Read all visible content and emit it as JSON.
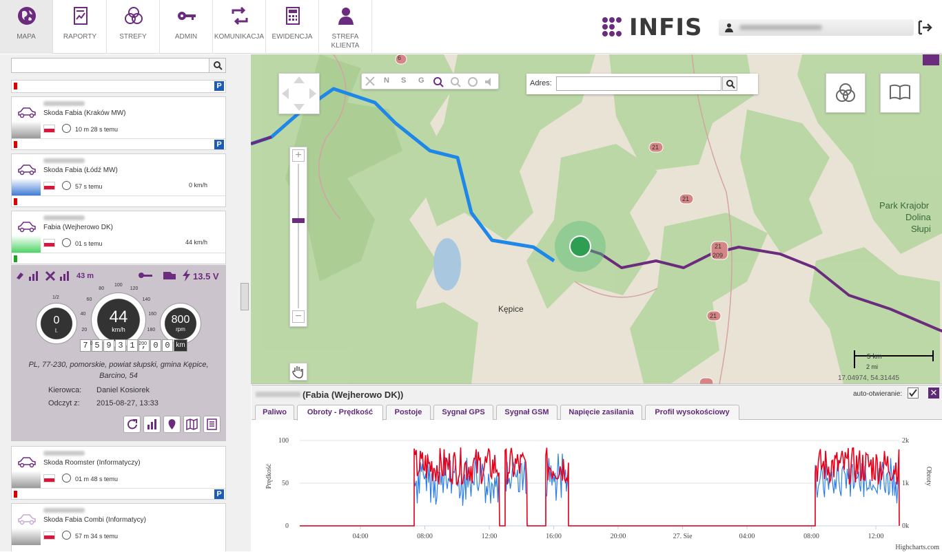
{
  "nav": [
    {
      "label": "MAPA",
      "icon": "globe-icon"
    },
    {
      "label": "RAPORTY",
      "icon": "report-icon"
    },
    {
      "label": "STREFY",
      "icon": "zones-icon"
    },
    {
      "label": "ADMIN",
      "icon": "key-icon"
    },
    {
      "label": "KOMUNIKACJA",
      "icon": "sync-icon"
    },
    {
      "label": "EWIDENCJA",
      "icon": "calculator-icon"
    },
    {
      "label": "STREFA KLIENTA",
      "icon": "user-icon"
    }
  ],
  "brand": {
    "logo": "INFIS",
    "accent": "#5e2a77"
  },
  "vehicles": [
    {
      "name": "Skoda Fabia (Kraków MW)",
      "time": "10 m 28 s temu",
      "speed": ""
    },
    {
      "name": "Skoda Fabia (Łódź MW)",
      "time": "57 s temu",
      "speed": "0 km/h"
    },
    {
      "name": "Fabia (Wejherowo DK)",
      "time": "01 s temu",
      "speed": "44 km/h"
    },
    {
      "name": "Skoda Roomster (Informatyczy)",
      "time": "01 m 48 s temu",
      "speed": ""
    },
    {
      "name": "Skoda Fabia Combi (Informatycy)",
      "time": "57 m 34 s temu",
      "speed": ""
    }
  ],
  "detail": {
    "altitude": "43 m",
    "voltage": "13.5 V",
    "fuel": "0",
    "fuel_unit": "l.",
    "fuel_ticks": [
      "1/2"
    ],
    "speed": "44",
    "speed_unit": "km/h",
    "speed_ticks": [
      "0",
      "20",
      "40",
      "60",
      "80",
      "100",
      "120",
      "140",
      "160",
      "180",
      "200"
    ],
    "rpm": "800",
    "rpm_unit": "rpm",
    "odometer": [
      "7",
      "5",
      "9",
      "3",
      "1",
      ",",
      "0",
      "0"
    ],
    "odo_unit": "km",
    "address_line1": "PL, 77-230, pomorskie, powiat słupski, gmina Kępice,",
    "address_line2": "Barcino, 54",
    "driver_label": "Kierowca:",
    "driver": "Daniel Kosiorek",
    "reading_label": "Odczyt z:",
    "reading": "2015-08-27, 13:33"
  },
  "map": {
    "address_label": "Adres:",
    "toolbar": [
      "N",
      "S",
      "G"
    ],
    "labels": {
      "town": "Kępice",
      "park1": "Park Krajobr",
      "park2": "Dolina",
      "park3": "Słupi",
      "road1": "21",
      "road2": "209",
      "road3": "6"
    },
    "scale_km": "5 km",
    "scale_mi": "2 mi",
    "coords": "17.04974, 54.31445"
  },
  "bottom": {
    "title": "(Fabia (Wejherowo DK))",
    "auto_open": "auto-otwieranie:",
    "tabs": [
      "Paliwo",
      "Obroty - Prędkość",
      "Postoje",
      "Sygnał GPS",
      "Sygnał GSM",
      "Napięcie zasilania",
      "Profil wysokościowy"
    ],
    "active_tab": 1
  },
  "chart_data": {
    "type": "line",
    "ylabel": "Prędkość",
    "y2label": "Obroty",
    "yticks": [
      "0",
      "50",
      "100"
    ],
    "y2ticks": [
      "0k",
      "1k",
      "2k"
    ],
    "xticks": [
      "04:00",
      "08:00",
      "12:00",
      "16:00",
      "20:00",
      "27. Sie",
      "04:00",
      "08:00",
      "12:00"
    ],
    "credit": "Highcharts.com",
    "series": [
      {
        "color": "#2a7fe8"
      },
      {
        "color": "#e8001a"
      }
    ]
  }
}
